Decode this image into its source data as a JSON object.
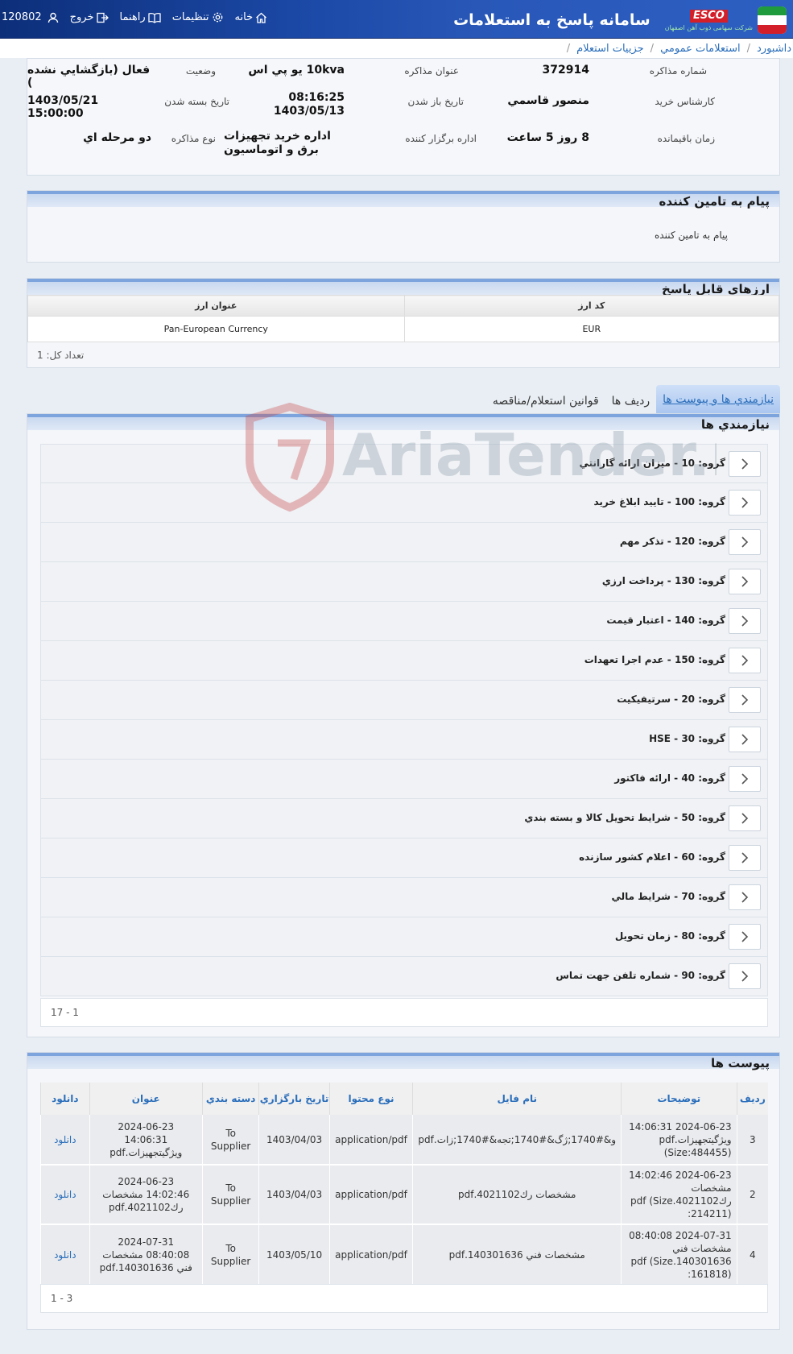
{
  "header": {
    "app_title": "سامانه پاسخ به استعلامات",
    "brand": "ESCO",
    "brand_subtitle": "شرکت سهامی ذوب آهن اصفهان",
    "nav": {
      "home": "خانه",
      "settings": "تنظیمات",
      "guide": "راهنما",
      "logout": "خروج",
      "user_id": "120802"
    }
  },
  "breadcrumb": [
    "داشبورد",
    "استعلامات عمومي",
    "جزييات استعلام"
  ],
  "summary": {
    "negotiation_number": {
      "label": "شماره مذاکره",
      "value": "372914"
    },
    "negotiation_title": {
      "label": "عنوان مذاکره",
      "value": "10kva يو پي اس"
    },
    "status": {
      "label": "وضعيت",
      "value": "فعال (بازگشايي نشده )"
    },
    "buyer_expert": {
      "label": "کارشناس خريد",
      "value": "منصور قاسمي"
    },
    "open_date": {
      "label": "تاريخ باز شدن",
      "value_time": "08:16:25",
      "value_date": "1403/05/13"
    },
    "close_date": {
      "label": "تاريخ بسته شدن",
      "value": "1403/05/21 15:00:00"
    },
    "remaining": {
      "label": "زمان باقيمانده",
      "value": "8 روز 5 ساعت"
    },
    "organizer": {
      "label": "اداره برگزار کننده",
      "value": "اداره خريد تجهيزات برق و اتوماسيون"
    },
    "negotiation_type": {
      "label": "نوع مذاکره",
      "value": "دو مرحله اي"
    }
  },
  "message": {
    "title": "پيام به تامين کننده",
    "text": "پيام به تامين کننده"
  },
  "currencies": {
    "title": "ارزهاي قابل پاسخ",
    "columns": [
      "کد ارز",
      "عنوان ارز"
    ],
    "rows": [
      {
        "code": "EUR",
        "name": "Pan-European Currency"
      }
    ],
    "count_text": "تعداد کل: 1"
  },
  "tabs": [
    {
      "label": "نيازمندي ها و پيوست ها",
      "active": true
    },
    {
      "label": "رديف ها",
      "active": false
    },
    {
      "label": "قوانين استعلام/مناقصه",
      "active": false
    }
  ],
  "requirements": {
    "title": "نيازمندي ها",
    "items": [
      "گروه: 10 - ميزان ارائه گارانتي",
      "گروه: 100 - تاييد ابلاغ خريد",
      "گروه: 120 - تذکر مهم",
      "گروه: 130 - پرداخت ارزي",
      "گروه: 140 - اعتبار قيمت",
      "گروه: 150 - عدم اجرا تعهدات",
      "گروه: 20 - سرتيفيکيت",
      "گروه: 30 - HSE",
      "گروه: 40 - ارائه فاکتور",
      "گروه: 50 - شرايط تحويل کالا و بسته بندي",
      "گروه: 60 - اعلام کشور سازنده",
      "گروه: 70 - شرايط مالي",
      "گروه: 80 - زمان تحويل",
      "گروه: 90 - شماره تلفن جهت تماس"
    ],
    "pager": "1 - 17"
  },
  "attachments": {
    "title": "پيوست ها",
    "columns": [
      "رديف",
      "توضيحات",
      "نام فايل",
      "نوع محتوا",
      "تاريخ بارگزاري",
      "دسته بندي",
      "عنوان",
      "دانلود"
    ],
    "rows": [
      {
        "row": "3",
        "description": "2024-06-23 14:06:31 ويژگيتجهيزات.pdf (Size:484455)",
        "file_name": "و&#1740;ژگ&#1740;تجه&#1740;زات.pdf",
        "content_type": "application/pdf",
        "upload_date": "1403/04/03",
        "category": "To Supplier",
        "title": "2024-06-23 14:06:31 ويژگيتجهيزات.pdf",
        "download": "دانلود"
      },
      {
        "row": "2",
        "description": "2024-06-23 14:02:46 مشخصات رك4021102.pdf (Size :214211)",
        "file_name": "مشخصات رك4021102.pdf",
        "content_type": "application/pdf",
        "upload_date": "1403/04/03",
        "category": "To Supplier",
        "title": "2024-06-23 14:02:46 مشخصات رك4021102.pdf",
        "download": "دانلود"
      },
      {
        "row": "4",
        "description": "2024-07-31 08:40:08 مشخصات فني 140301636.pdf (Size :161818)",
        "file_name": "مشخصات فني 140301636.pdf",
        "content_type": "application/pdf",
        "upload_date": "1403/05/10",
        "category": "To Supplier",
        "title": "2024-07-31 08:40:08 مشخصات فني 140301636.pdf",
        "download": "دانلود"
      }
    ],
    "pager": "1 - 3"
  },
  "watermark": "AriaTender.neT",
  "colors": {
    "header_bg": "#1c4aa8",
    "link": "#2a6ebb",
    "panel_head": "#c9d8f0",
    "brand_red": "#d31f2a"
  }
}
